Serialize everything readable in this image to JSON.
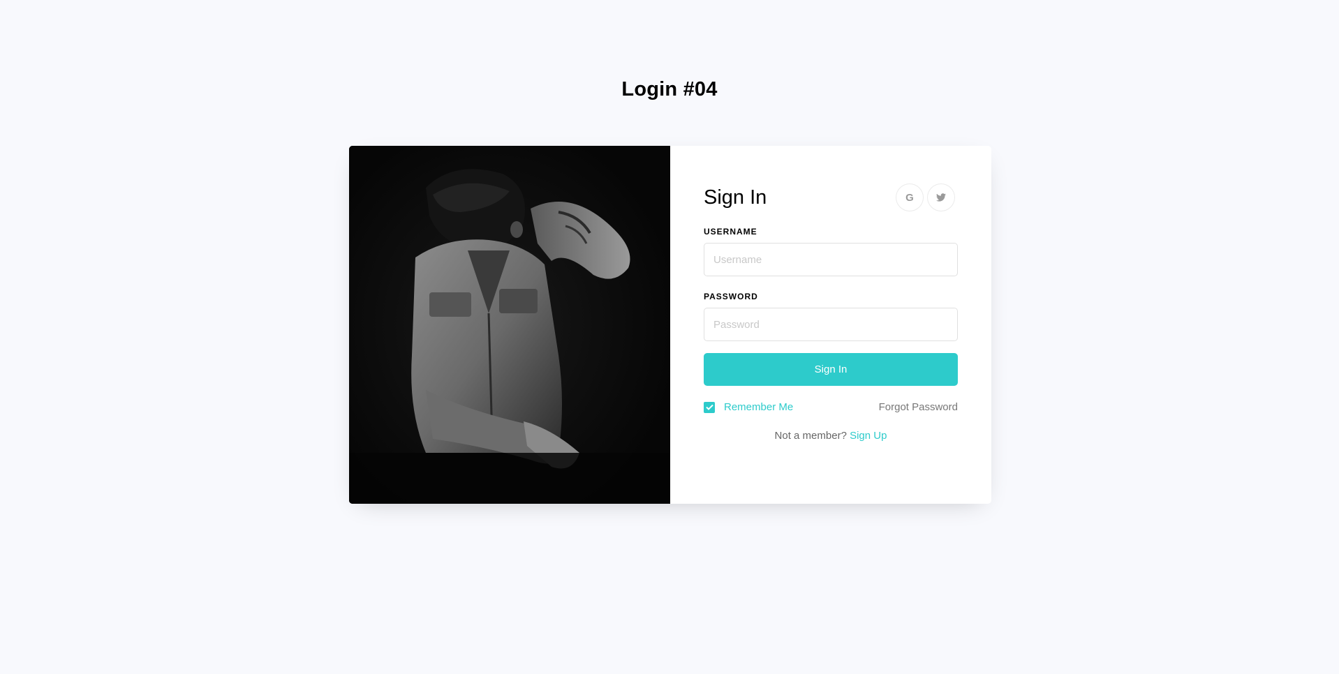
{
  "page": {
    "heading": "Login #04"
  },
  "form": {
    "title": "Sign In",
    "social": [
      {
        "icon": "google-icon",
        "glyph": "G"
      },
      {
        "icon": "twitter-icon",
        "glyph": ""
      }
    ],
    "username": {
      "label": "USERNAME",
      "placeholder": "Username",
      "value": ""
    },
    "password": {
      "label": "PASSWORD",
      "placeholder": "Password",
      "value": ""
    },
    "submit_label": "Sign In",
    "remember_label": "Remember Me",
    "remember_checked": true,
    "forgot_label": "Forgot Password",
    "signup_prompt": "Not a member?",
    "signup_link": "Sign Up"
  },
  "colors": {
    "accent": "#2dcbcb",
    "background": "#f8f9fd"
  }
}
